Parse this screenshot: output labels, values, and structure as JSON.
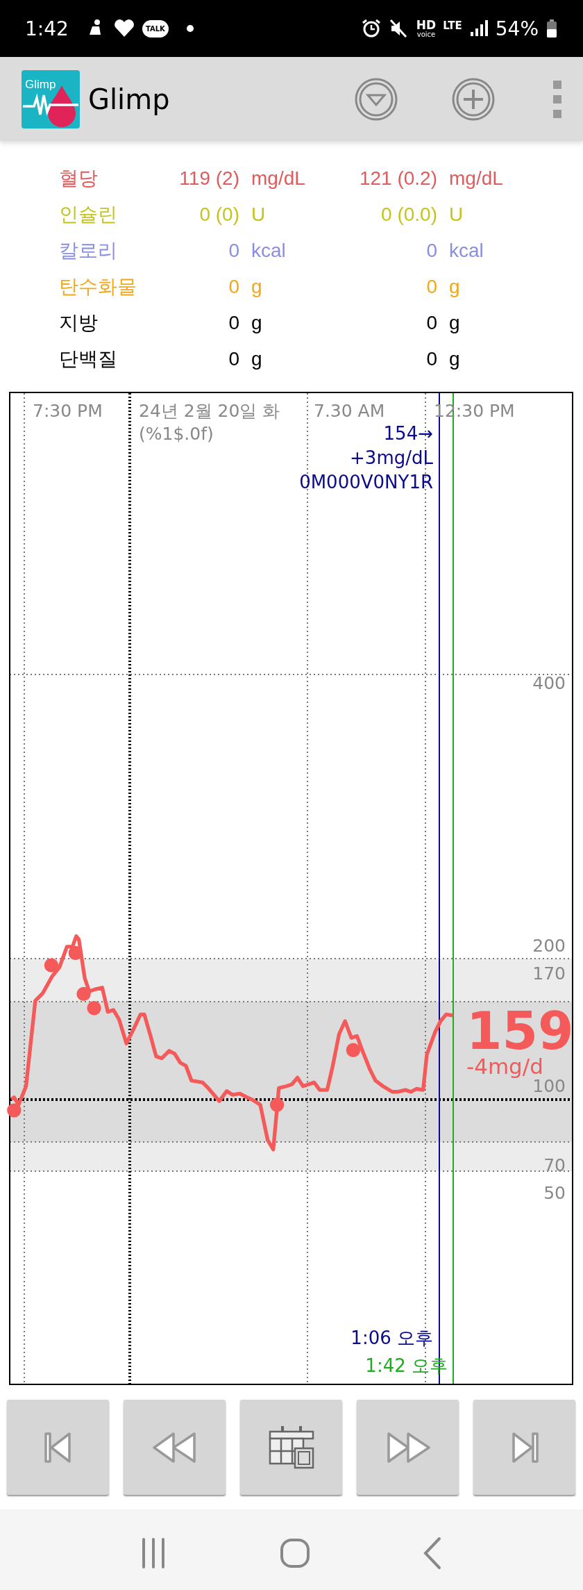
{
  "status_bar": {
    "time": "1:42",
    "talk_badge": "TALK",
    "hd": "HD",
    "voice": "voice",
    "network": "LTE",
    "battery": "54%"
  },
  "app_bar": {
    "logo_text": "Glimp",
    "title": "Glimp"
  },
  "summary": [
    {
      "label": "혈당",
      "number_1": "119 (2)",
      "unit_1": "mg/dL",
      "number_2": "121 (0.2)",
      "unit_2": "mg/dL",
      "color": "#e05c5c"
    },
    {
      "label": "인슐린",
      "number_1": "0 (0)",
      "unit_1": "U",
      "number_2": "0 (0.0)",
      "unit_2": "U",
      "color": "#c4c41e"
    },
    {
      "label": "칼로리",
      "number_1": "0",
      "unit_1": "kcal",
      "number_2": "0",
      "unit_2": "kcal",
      "color": "#8a8ee0"
    },
    {
      "label": "탄수화물",
      "number_1": "0",
      "unit_1": "g",
      "number_2": "0",
      "unit_2": "g",
      "color": "#f0a818"
    },
    {
      "label": "지방",
      "number_1": "0",
      "unit_1": "g",
      "number_2": "0",
      "unit_2": "g",
      "color": "#000000"
    },
    {
      "label": "단백질",
      "number_1": "0",
      "unit_1": "g",
      "number_2": "0",
      "unit_2": "g",
      "color": "#000000"
    }
  ],
  "chart": {
    "x_labels": [
      "7:30 PM",
      "24년 2월 20일 화",
      "7.30 AM",
      "12:30 PM"
    ],
    "date_format": "(%1$.0f)",
    "y_labels": [
      "400",
      "200",
      "170",
      "100",
      "70",
      "50"
    ],
    "marker": {
      "value": "154→",
      "delta": "+3mg/dL",
      "serial": "0M000V0NY1R",
      "time": "1:06 오후"
    },
    "current": {
      "value": "159",
      "delta": "-4mg/d",
      "time": "1:42 오후"
    }
  }
}
